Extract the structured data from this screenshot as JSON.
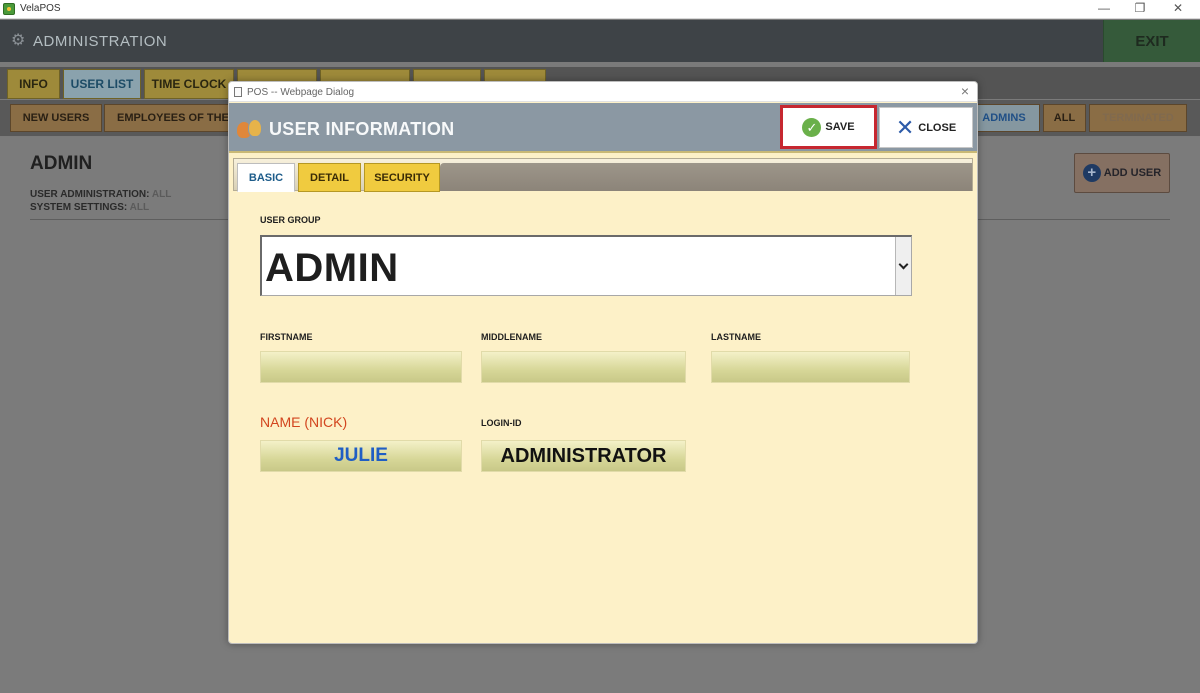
{
  "app": {
    "title": "VelaPOS",
    "window_controls": {
      "minimize": "—",
      "restore": "❐",
      "close": "✕"
    }
  },
  "header": {
    "title": "ADMINISTRATION",
    "exit_label": "EXIT"
  },
  "main_tabs": [
    {
      "label": "INFO",
      "active": false
    },
    {
      "label": "USER LIST",
      "active": true
    },
    {
      "label": "TIME CLOCK",
      "active": false
    }
  ],
  "sub_tabs": [
    {
      "label": "NEW USERS",
      "active": false
    },
    {
      "label": "EMPLOYEES OF THE",
      "active": false
    },
    {
      "label": "ADMINS",
      "active": true
    },
    {
      "label": "ALL",
      "active": false
    },
    {
      "label": "TERMINATED",
      "active": false
    }
  ],
  "background_panel": {
    "title": "ADMIN",
    "lines": [
      {
        "label": "USER ADMINISTRATION:",
        "value": "ALL"
      },
      {
        "label": "SYSTEM SETTINGS:",
        "value": "ALL"
      }
    ],
    "add_user_label": "ADD USER"
  },
  "dialog": {
    "window_title": "POS -- Webpage Dialog",
    "close_glyph": "×",
    "header_title": "USER INFORMATION",
    "save_label": "SAVE",
    "close_label": "CLOSE",
    "tabs": [
      {
        "label": "BASIC",
        "active": true
      },
      {
        "label": "DETAIL",
        "active": false
      },
      {
        "label": "SECURITY",
        "active": false
      }
    ],
    "user_group": {
      "label": "USER GROUP",
      "value": "ADMIN"
    },
    "firstname": {
      "label": "FIRSTNAME",
      "value": ""
    },
    "middlename": {
      "label": "MIDDLENAME",
      "value": ""
    },
    "lastname": {
      "label": "LASTNAME",
      "value": ""
    },
    "nick": {
      "label": "NAME (NICK)",
      "value": "JULIE"
    },
    "login_id": {
      "label": "LOGIN-ID",
      "value": "ADMINISTRATOR"
    }
  },
  "colors": {
    "save_highlight": "#c62730",
    "nick_label": "#d2451e",
    "nick_value": "#1f5ec4",
    "active_tab_text": "#1d5c8a"
  }
}
